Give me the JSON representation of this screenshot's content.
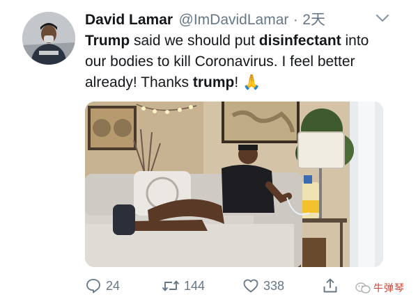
{
  "tweet": {
    "author_name": "David Lamar",
    "handle": "@ImDavidLamar",
    "separator": "·",
    "time": "2天",
    "text": {
      "t1": "Trump",
      "t2": " said we should put ",
      "t3": "disinfectant",
      "t4": " into our bodies to kill Coronavirus. I feel better already! Thanks ",
      "t5": "trump",
      "t6": "!",
      "t7": " 🙏"
    }
  },
  "actions": {
    "replies": "24",
    "retweets": "144",
    "likes": "338"
  },
  "watermark": {
    "label": "牛弹琴"
  },
  "icons": {
    "avatar": "avatar",
    "more": "chevron-down-icon",
    "reply": "reply-icon",
    "retweet": "retweet-icon",
    "like": "heart-icon",
    "share": "share-icon",
    "watermark": "wechat-icon"
  },
  "colors": {
    "text": "#14171a",
    "secondary": "#657786",
    "background": "#ffffff",
    "watermark": "#cc4433"
  }
}
